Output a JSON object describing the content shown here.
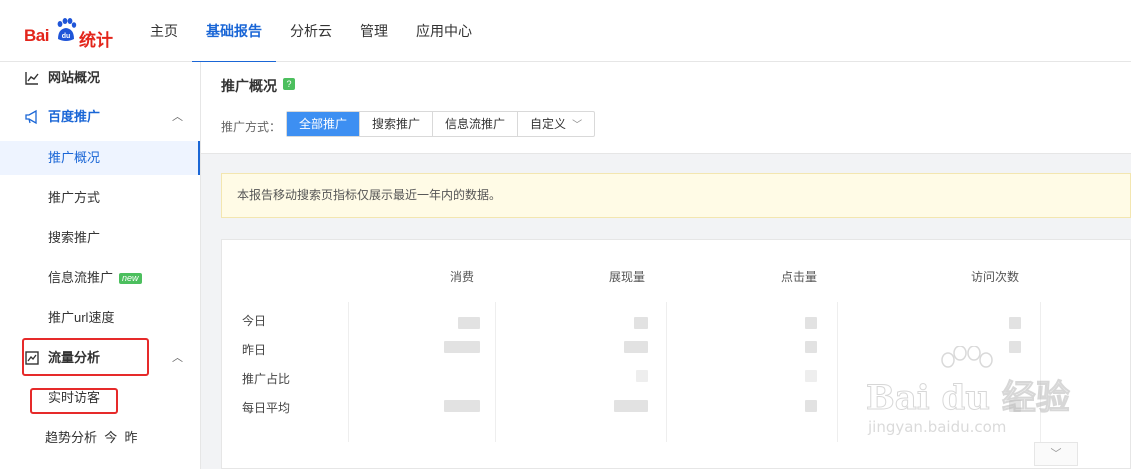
{
  "brand": {
    "logo_bai": "Bai",
    "logo_du": "du",
    "logo_tongji": "统计"
  },
  "nav": {
    "items": [
      {
        "label": "主页",
        "active": false
      },
      {
        "label": "基础报告",
        "active": true
      },
      {
        "label": "分析云",
        "active": false
      },
      {
        "label": "管理",
        "active": false
      },
      {
        "label": "应用中心",
        "active": false
      }
    ]
  },
  "sidebar": {
    "site_overview": "网站概况",
    "baidu_promo": "百度推广",
    "promo_overview": "推广概况",
    "promo_method": "推广方式",
    "search_promo": "搜索推广",
    "feed_promo": "信息流推广",
    "feed_badge": "new",
    "url_speed": "推广url速度",
    "traffic_analysis": "流量分析",
    "realtime_visitors": "实时访客",
    "trend_analysis": "趋势分析",
    "trend_today": "今",
    "trend_yesterday": "昨"
  },
  "main": {
    "title": "推广概况",
    "help": "?",
    "mode_label": "推广方式：",
    "modes": [
      "全部推广",
      "搜索推广",
      "信息流推广",
      "自定义"
    ],
    "notice": "本报告移动搜索页指标仅展示最近一年内的数据。",
    "columns": [
      "消费",
      "展现量",
      "点击量",
      "访问次数"
    ],
    "rows": [
      "今日",
      "昨日",
      "推广占比",
      "每日平均"
    ]
  },
  "watermark": {
    "brand": "Bai du 经验",
    "url": "jingyan.baidu.com"
  },
  "colors": {
    "accent": "#1a66d6",
    "segment_active": "#3d8ff2",
    "brand_red": "#e3251b",
    "highlight_box": "#e62a2a",
    "notice_bg": "#fffbe6"
  }
}
